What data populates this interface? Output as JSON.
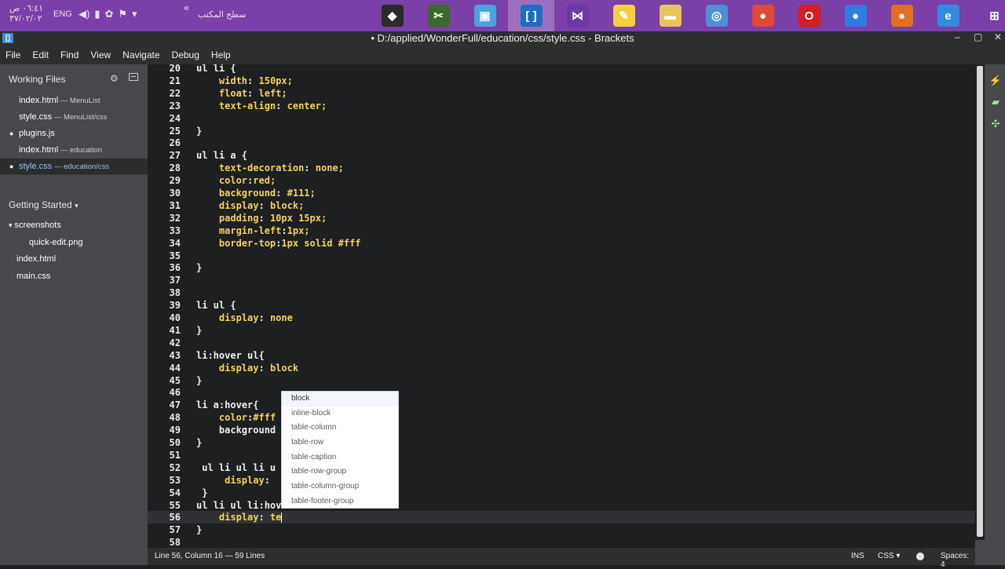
{
  "taskbar": {
    "clock_time": "٠٦:٤١ ص",
    "clock_date": "٣٧/٠٢/٠٢",
    "lang": "ENG",
    "desktop_label": "سطح المكتب",
    "apps": [
      {
        "icon": "app-icon",
        "glyph": "◆",
        "color": "#2b2b2b"
      },
      {
        "icon": "app-icon",
        "glyph": "✂",
        "color": "#3b6b2a"
      },
      {
        "icon": "app-icon",
        "glyph": "▣",
        "color": "#4aa3e0"
      },
      {
        "icon": "brackets-icon",
        "glyph": "[ ]",
        "color": "#1b6fc2",
        "active": true
      },
      {
        "icon": "visual-studio-icon",
        "glyph": "⋈",
        "color": "#6a3aa5"
      },
      {
        "icon": "notepad-icon",
        "glyph": "✎",
        "color": "#f4d03f"
      },
      {
        "icon": "folder-icon",
        "glyph": "▬",
        "color": "#e8c55a"
      },
      {
        "icon": "browser-icon",
        "glyph": "◎",
        "color": "#4f8fd6"
      },
      {
        "icon": "chrome-icon",
        "glyph": "●",
        "color": "#e04a36"
      },
      {
        "icon": "opera-icon",
        "glyph": "O",
        "color": "#d61f1f"
      },
      {
        "icon": "browser-icon",
        "glyph": "●",
        "color": "#2d7de0"
      },
      {
        "icon": "firefox-icon",
        "glyph": "●",
        "color": "#e2701d"
      },
      {
        "icon": "ie-icon",
        "glyph": "e",
        "color": "#2f8ee0"
      },
      {
        "icon": "windows-icon",
        "glyph": "⊞",
        "color": "#7b3fa8"
      }
    ]
  },
  "window": {
    "title": "• D:/applied/WonderFull/education/css/style.css - Brackets"
  },
  "menu": [
    "File",
    "Edit",
    "Find",
    "View",
    "Navigate",
    "Debug",
    "Help"
  ],
  "sidebar": {
    "working_files_title": "Working Files",
    "working_files": [
      {
        "name": "index.html",
        "dir": " — MenuList",
        "dot": false,
        "selected": false
      },
      {
        "name": "style.css",
        "dir": " — MenuList/css",
        "dot": false,
        "selected": false
      },
      {
        "name": "plugins.js",
        "dir": "",
        "dot": true,
        "selected": false
      },
      {
        "name": "index.html",
        "dir": " — education",
        "dot": false,
        "selected": false
      },
      {
        "name": "style.css",
        "dir": " — education/css",
        "dot": true,
        "selected": true
      }
    ],
    "project_title": "Getting Started",
    "tree": [
      {
        "name": "screenshots",
        "caret": "▾",
        "level": 0
      },
      {
        "name": "quick-edit.png",
        "caret": "",
        "level": 1
      },
      {
        "name": "index.html",
        "caret": "",
        "level": 0
      },
      {
        "name": "main.css",
        "caret": "",
        "level": 0
      }
    ]
  },
  "editor": {
    "lines": [
      {
        "n": "20",
        "text": "ul li {"
      },
      {
        "n": "21",
        "text": "    width: 150px;"
      },
      {
        "n": "22",
        "text": "    float: left;"
      },
      {
        "n": "23",
        "text": "    text-align: center;"
      },
      {
        "n": "24",
        "text": ""
      },
      {
        "n": "25",
        "text": "}"
      },
      {
        "n": "26",
        "text": ""
      },
      {
        "n": "27",
        "text": "ul li a {"
      },
      {
        "n": "28",
        "text": "    text-decoration: none;"
      },
      {
        "n": "29",
        "text": "    color:red;"
      },
      {
        "n": "30",
        "text": "    background: #111;"
      },
      {
        "n": "31",
        "text": "    display: block;"
      },
      {
        "n": "32",
        "text": "    padding: 10px 15px;"
      },
      {
        "n": "33",
        "text": "    margin-left:1px;"
      },
      {
        "n": "34",
        "text": "    border-top:1px solid #fff"
      },
      {
        "n": "35",
        "text": ""
      },
      {
        "n": "36",
        "text": "}"
      },
      {
        "n": "37",
        "text": ""
      },
      {
        "n": "38",
        "text": ""
      },
      {
        "n": "39",
        "text": "li ul {"
      },
      {
        "n": "40",
        "text": "    display: none"
      },
      {
        "n": "41",
        "text": "}"
      },
      {
        "n": "42",
        "text": ""
      },
      {
        "n": "43",
        "text": "li:hover ul{"
      },
      {
        "n": "44",
        "text": "    display: block"
      },
      {
        "n": "45",
        "text": "}"
      },
      {
        "n": "46",
        "text": ""
      },
      {
        "n": "47",
        "text": "li a:hover{"
      },
      {
        "n": "48",
        "text": "    color:#fff"
      },
      {
        "n": "49",
        "text": "    background"
      },
      {
        "n": "50",
        "text": "}"
      },
      {
        "n": "51",
        "text": ""
      },
      {
        "n": "52",
        "text": " ul li ul li u"
      },
      {
        "n": "53",
        "text": "     display: "
      },
      {
        "n": "54",
        "text": " }"
      },
      {
        "n": "55",
        "text": "ul li ul li:hov"
      },
      {
        "n": "56",
        "text": "    display: te",
        "current": true
      },
      {
        "n": "57",
        "text": "}"
      },
      {
        "n": "58",
        "text": ""
      }
    ],
    "hints": [
      "block",
      "inline-block",
      "table-column",
      "table-row",
      "table-caption",
      "table-row-group",
      "table-column-group",
      "table-footer-group"
    ]
  },
  "statusbar": {
    "position": "Line 56, Column 16 — 59 Lines",
    "ins": "INS",
    "mode": "CSS ▾",
    "spaces": "Spaces: 4"
  }
}
